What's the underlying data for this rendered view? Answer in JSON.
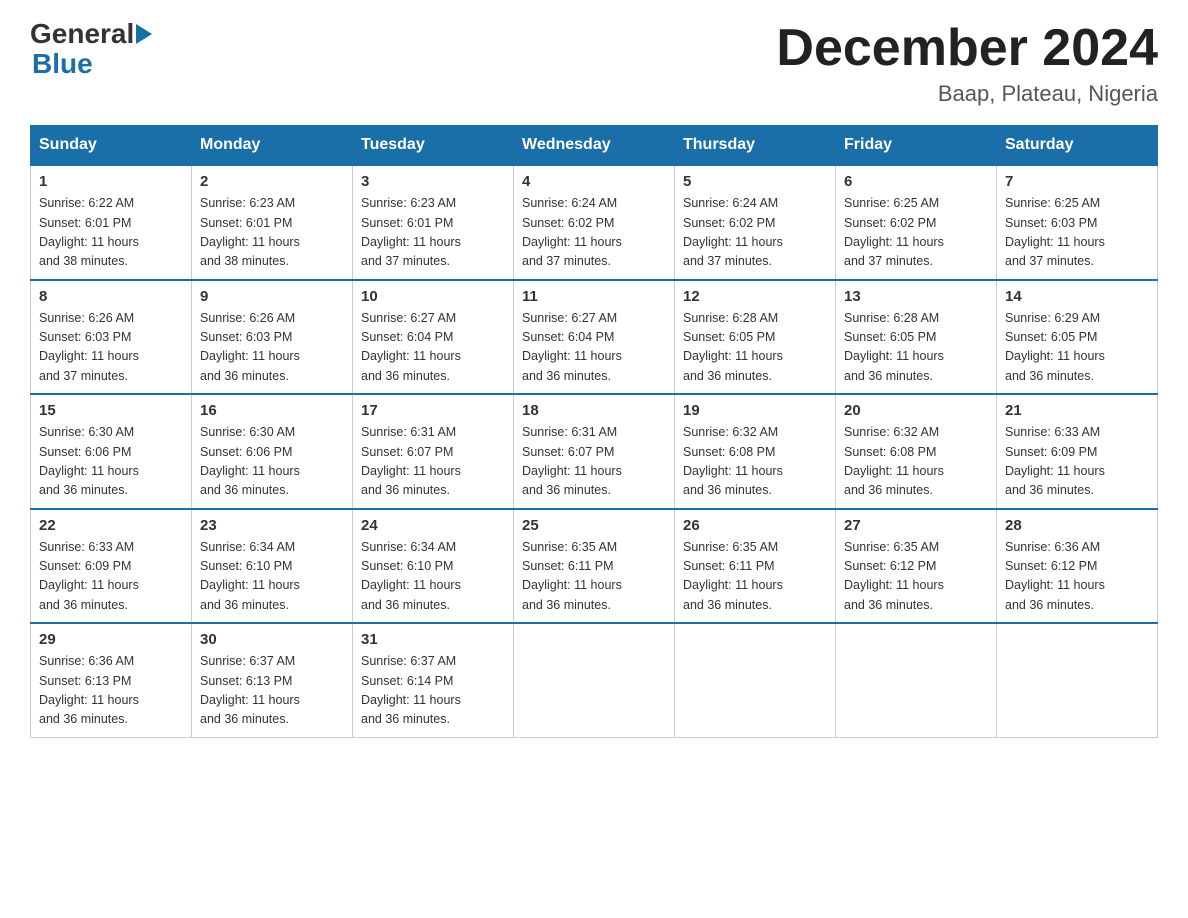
{
  "header": {
    "logo_general": "General",
    "logo_blue": "Blue",
    "month_title": "December 2024",
    "location": "Baap, Plateau, Nigeria"
  },
  "days_of_week": [
    "Sunday",
    "Monday",
    "Tuesday",
    "Wednesday",
    "Thursday",
    "Friday",
    "Saturday"
  ],
  "weeks": [
    [
      {
        "day": "1",
        "sunrise": "6:22 AM",
        "sunset": "6:01 PM",
        "daylight": "11 hours and 38 minutes."
      },
      {
        "day": "2",
        "sunrise": "6:23 AM",
        "sunset": "6:01 PM",
        "daylight": "11 hours and 38 minutes."
      },
      {
        "day": "3",
        "sunrise": "6:23 AM",
        "sunset": "6:01 PM",
        "daylight": "11 hours and 37 minutes."
      },
      {
        "day": "4",
        "sunrise": "6:24 AM",
        "sunset": "6:02 PM",
        "daylight": "11 hours and 37 minutes."
      },
      {
        "day": "5",
        "sunrise": "6:24 AM",
        "sunset": "6:02 PM",
        "daylight": "11 hours and 37 minutes."
      },
      {
        "day": "6",
        "sunrise": "6:25 AM",
        "sunset": "6:02 PM",
        "daylight": "11 hours and 37 minutes."
      },
      {
        "day": "7",
        "sunrise": "6:25 AM",
        "sunset": "6:03 PM",
        "daylight": "11 hours and 37 minutes."
      }
    ],
    [
      {
        "day": "8",
        "sunrise": "6:26 AM",
        "sunset": "6:03 PM",
        "daylight": "11 hours and 37 minutes."
      },
      {
        "day": "9",
        "sunrise": "6:26 AM",
        "sunset": "6:03 PM",
        "daylight": "11 hours and 36 minutes."
      },
      {
        "day": "10",
        "sunrise": "6:27 AM",
        "sunset": "6:04 PM",
        "daylight": "11 hours and 36 minutes."
      },
      {
        "day": "11",
        "sunrise": "6:27 AM",
        "sunset": "6:04 PM",
        "daylight": "11 hours and 36 minutes."
      },
      {
        "day": "12",
        "sunrise": "6:28 AM",
        "sunset": "6:05 PM",
        "daylight": "11 hours and 36 minutes."
      },
      {
        "day": "13",
        "sunrise": "6:28 AM",
        "sunset": "6:05 PM",
        "daylight": "11 hours and 36 minutes."
      },
      {
        "day": "14",
        "sunrise": "6:29 AM",
        "sunset": "6:05 PM",
        "daylight": "11 hours and 36 minutes."
      }
    ],
    [
      {
        "day": "15",
        "sunrise": "6:30 AM",
        "sunset": "6:06 PM",
        "daylight": "11 hours and 36 minutes."
      },
      {
        "day": "16",
        "sunrise": "6:30 AM",
        "sunset": "6:06 PM",
        "daylight": "11 hours and 36 minutes."
      },
      {
        "day": "17",
        "sunrise": "6:31 AM",
        "sunset": "6:07 PM",
        "daylight": "11 hours and 36 minutes."
      },
      {
        "day": "18",
        "sunrise": "6:31 AM",
        "sunset": "6:07 PM",
        "daylight": "11 hours and 36 minutes."
      },
      {
        "day": "19",
        "sunrise": "6:32 AM",
        "sunset": "6:08 PM",
        "daylight": "11 hours and 36 minutes."
      },
      {
        "day": "20",
        "sunrise": "6:32 AM",
        "sunset": "6:08 PM",
        "daylight": "11 hours and 36 minutes."
      },
      {
        "day": "21",
        "sunrise": "6:33 AM",
        "sunset": "6:09 PM",
        "daylight": "11 hours and 36 minutes."
      }
    ],
    [
      {
        "day": "22",
        "sunrise": "6:33 AM",
        "sunset": "6:09 PM",
        "daylight": "11 hours and 36 minutes."
      },
      {
        "day": "23",
        "sunrise": "6:34 AM",
        "sunset": "6:10 PM",
        "daylight": "11 hours and 36 minutes."
      },
      {
        "day": "24",
        "sunrise": "6:34 AM",
        "sunset": "6:10 PM",
        "daylight": "11 hours and 36 minutes."
      },
      {
        "day": "25",
        "sunrise": "6:35 AM",
        "sunset": "6:11 PM",
        "daylight": "11 hours and 36 minutes."
      },
      {
        "day": "26",
        "sunrise": "6:35 AM",
        "sunset": "6:11 PM",
        "daylight": "11 hours and 36 minutes."
      },
      {
        "day": "27",
        "sunrise": "6:35 AM",
        "sunset": "6:12 PM",
        "daylight": "11 hours and 36 minutes."
      },
      {
        "day": "28",
        "sunrise": "6:36 AM",
        "sunset": "6:12 PM",
        "daylight": "11 hours and 36 minutes."
      }
    ],
    [
      {
        "day": "29",
        "sunrise": "6:36 AM",
        "sunset": "6:13 PM",
        "daylight": "11 hours and 36 minutes."
      },
      {
        "day": "30",
        "sunrise": "6:37 AM",
        "sunset": "6:13 PM",
        "daylight": "11 hours and 36 minutes."
      },
      {
        "day": "31",
        "sunrise": "6:37 AM",
        "sunset": "6:14 PM",
        "daylight": "11 hours and 36 minutes."
      },
      null,
      null,
      null,
      null
    ]
  ],
  "labels": {
    "sunrise": "Sunrise:",
    "sunset": "Sunset:",
    "daylight": "Daylight:"
  }
}
